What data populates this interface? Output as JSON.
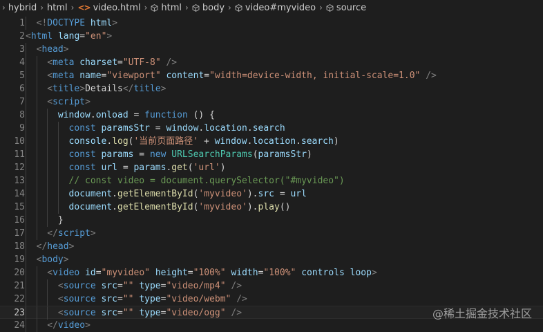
{
  "breadcrumb": [
    {
      "label": "hybrid",
      "icon": "chevron-right-icon"
    },
    {
      "label": "html",
      "icon": "folder-icon"
    },
    {
      "label": "video.html",
      "icon": "html-file-icon"
    },
    {
      "label": "html",
      "icon": "cube-icon"
    },
    {
      "label": "body",
      "icon": "cube-icon"
    },
    {
      "label": "video#myvideo",
      "icon": "cube-icon"
    },
    {
      "label": "source",
      "icon": "cube-icon"
    }
  ],
  "current_line": 23,
  "lines": [
    {
      "n": "1",
      "indent": 1,
      "tokens": [
        [
          "c-doc",
          "<!"
        ],
        [
          "c-tag",
          "DOCTYPE"
        ],
        [
          "c-txt",
          " "
        ],
        [
          "c-attr",
          "html"
        ],
        [
          "c-doc",
          ">"
        ]
      ]
    },
    {
      "n": "2",
      "indent": 0,
      "tokens": [
        [
          "c-br",
          "<"
        ],
        [
          "c-tag",
          "html"
        ],
        [
          "c-txt",
          " "
        ],
        [
          "c-attr",
          "lang"
        ],
        [
          "c-txt",
          "="
        ],
        [
          "c-str",
          "\"en\""
        ],
        [
          "c-br",
          ">"
        ]
      ]
    },
    {
      "n": "3",
      "indent": 1,
      "tokens": [
        [
          "c-br",
          "<"
        ],
        [
          "c-tag",
          "head"
        ],
        [
          "c-br",
          ">"
        ]
      ]
    },
    {
      "n": "4",
      "indent": 2,
      "tokens": [
        [
          "c-br",
          "<"
        ],
        [
          "c-tag",
          "meta"
        ],
        [
          "c-txt",
          " "
        ],
        [
          "c-attr",
          "charset"
        ],
        [
          "c-txt",
          "="
        ],
        [
          "c-str",
          "\"UTF-8\""
        ],
        [
          "c-txt",
          " "
        ],
        [
          "c-br",
          "/>"
        ]
      ]
    },
    {
      "n": "5",
      "indent": 2,
      "tokens": [
        [
          "c-br",
          "<"
        ],
        [
          "c-tag",
          "meta"
        ],
        [
          "c-txt",
          " "
        ],
        [
          "c-attr",
          "name"
        ],
        [
          "c-txt",
          "="
        ],
        [
          "c-str",
          "\"viewport\""
        ],
        [
          "c-txt",
          " "
        ],
        [
          "c-attr",
          "content"
        ],
        [
          "c-txt",
          "="
        ],
        [
          "c-str",
          "\"width=device-width, initial-scale=1.0\""
        ],
        [
          "c-txt",
          " "
        ],
        [
          "c-br",
          "/>"
        ]
      ]
    },
    {
      "n": "6",
      "indent": 2,
      "tokens": [
        [
          "c-br",
          "<"
        ],
        [
          "c-tag",
          "title"
        ],
        [
          "c-br",
          ">"
        ],
        [
          "c-txt",
          "Details"
        ],
        [
          "c-br",
          "</"
        ],
        [
          "c-tag",
          "title"
        ],
        [
          "c-br",
          ">"
        ]
      ]
    },
    {
      "n": "7",
      "indent": 2,
      "tokens": [
        [
          "c-br",
          "<"
        ],
        [
          "c-tag",
          "script"
        ],
        [
          "c-br",
          ">"
        ]
      ]
    },
    {
      "n": "8",
      "indent": 3,
      "tokens": [
        [
          "c-var",
          "window"
        ],
        [
          "c-txt",
          "."
        ],
        [
          "c-var",
          "onload"
        ],
        [
          "c-txt",
          " = "
        ],
        [
          "c-kw",
          "function"
        ],
        [
          "c-txt",
          " () {"
        ]
      ]
    },
    {
      "n": "9",
      "indent": 4,
      "tokens": [
        [
          "c-kw",
          "const"
        ],
        [
          "c-txt",
          " "
        ],
        [
          "c-var",
          "paramsStr"
        ],
        [
          "c-txt",
          " = "
        ],
        [
          "c-var",
          "window"
        ],
        [
          "c-txt",
          "."
        ],
        [
          "c-var",
          "location"
        ],
        [
          "c-txt",
          "."
        ],
        [
          "c-var",
          "search"
        ]
      ]
    },
    {
      "n": "10",
      "indent": 4,
      "tokens": [
        [
          "c-var",
          "console"
        ],
        [
          "c-txt",
          "."
        ],
        [
          "c-fn",
          "log"
        ],
        [
          "c-txt",
          "("
        ],
        [
          "c-str",
          "'当前页面路径'"
        ],
        [
          "c-txt",
          " + "
        ],
        [
          "c-var",
          "window"
        ],
        [
          "c-txt",
          "."
        ],
        [
          "c-var",
          "location"
        ],
        [
          "c-txt",
          "."
        ],
        [
          "c-var",
          "search"
        ],
        [
          "c-txt",
          ")"
        ]
      ]
    },
    {
      "n": "11",
      "indent": 4,
      "tokens": [
        [
          "c-kw",
          "const"
        ],
        [
          "c-txt",
          " "
        ],
        [
          "c-var",
          "params"
        ],
        [
          "c-txt",
          " = "
        ],
        [
          "c-kw",
          "new"
        ],
        [
          "c-txt",
          " "
        ],
        [
          "c-cls",
          "URLSearchParams"
        ],
        [
          "c-txt",
          "("
        ],
        [
          "c-var",
          "paramsStr"
        ],
        [
          "c-txt",
          ")"
        ]
      ]
    },
    {
      "n": "12",
      "indent": 4,
      "tokens": [
        [
          "c-kw",
          "const"
        ],
        [
          "c-txt",
          " "
        ],
        [
          "c-var",
          "url"
        ],
        [
          "c-txt",
          " = "
        ],
        [
          "c-var",
          "params"
        ],
        [
          "c-txt",
          "."
        ],
        [
          "c-fn",
          "get"
        ],
        [
          "c-txt",
          "("
        ],
        [
          "c-str",
          "'url'"
        ],
        [
          "c-txt",
          ")"
        ]
      ]
    },
    {
      "n": "13",
      "indent": 4,
      "tokens": [
        [
          "c-cmt",
          "// const video = document.querySelector(\"#myvideo\")"
        ]
      ]
    },
    {
      "n": "14",
      "indent": 4,
      "tokens": [
        [
          "c-var",
          "document"
        ],
        [
          "c-txt",
          "."
        ],
        [
          "c-fn",
          "getElementById"
        ],
        [
          "c-txt",
          "("
        ],
        [
          "c-str",
          "'myvideo'"
        ],
        [
          "c-txt",
          ")."
        ],
        [
          "c-var",
          "src"
        ],
        [
          "c-txt",
          " = "
        ],
        [
          "c-var",
          "url"
        ]
      ]
    },
    {
      "n": "15",
      "indent": 4,
      "tokens": [
        [
          "c-var",
          "document"
        ],
        [
          "c-txt",
          "."
        ],
        [
          "c-fn",
          "getElementById"
        ],
        [
          "c-txt",
          "("
        ],
        [
          "c-str",
          "'myvideo'"
        ],
        [
          "c-txt",
          ")."
        ],
        [
          "c-fn",
          "play"
        ],
        [
          "c-txt",
          "()"
        ]
      ]
    },
    {
      "n": "16",
      "indent": 3,
      "tokens": [
        [
          "c-txt",
          "}"
        ]
      ]
    },
    {
      "n": "17",
      "indent": 2,
      "tokens": [
        [
          "c-br",
          "</"
        ],
        [
          "c-tag",
          "script"
        ],
        [
          "c-br",
          ">"
        ]
      ]
    },
    {
      "n": "18",
      "indent": 1,
      "tokens": [
        [
          "c-br",
          "</"
        ],
        [
          "c-tag",
          "head"
        ],
        [
          "c-br",
          ">"
        ]
      ]
    },
    {
      "n": "19",
      "indent": 1,
      "tokens": [
        [
          "c-br",
          "<"
        ],
        [
          "c-tag",
          "body"
        ],
        [
          "c-br",
          ">"
        ]
      ]
    },
    {
      "n": "20",
      "indent": 2,
      "tokens": [
        [
          "c-br",
          "<"
        ],
        [
          "c-tag",
          "video"
        ],
        [
          "c-txt",
          " "
        ],
        [
          "c-attr",
          "id"
        ],
        [
          "c-txt",
          "="
        ],
        [
          "c-str",
          "\"myvideo\""
        ],
        [
          "c-txt",
          " "
        ],
        [
          "c-attr",
          "height"
        ],
        [
          "c-txt",
          "="
        ],
        [
          "c-str",
          "\"100%\""
        ],
        [
          "c-txt",
          " "
        ],
        [
          "c-attr",
          "width"
        ],
        [
          "c-txt",
          "="
        ],
        [
          "c-str",
          "\"100%\""
        ],
        [
          "c-txt",
          " "
        ],
        [
          "c-attr",
          "controls"
        ],
        [
          "c-txt",
          " "
        ],
        [
          "c-attr",
          "loop"
        ],
        [
          "c-br",
          ">"
        ]
      ]
    },
    {
      "n": "21",
      "indent": 3,
      "tokens": [
        [
          "c-br",
          "<"
        ],
        [
          "c-tag",
          "source"
        ],
        [
          "c-txt",
          " "
        ],
        [
          "c-attr",
          "src"
        ],
        [
          "c-txt",
          "="
        ],
        [
          "c-str",
          "\"\""
        ],
        [
          "c-txt",
          " "
        ],
        [
          "c-attr",
          "type"
        ],
        [
          "c-txt",
          "="
        ],
        [
          "c-str",
          "\"video/mp4\""
        ],
        [
          "c-txt",
          " "
        ],
        [
          "c-br",
          "/>"
        ]
      ]
    },
    {
      "n": "22",
      "indent": 3,
      "tokens": [
        [
          "c-br",
          "<"
        ],
        [
          "c-tag",
          "source"
        ],
        [
          "c-txt",
          " "
        ],
        [
          "c-attr",
          "src"
        ],
        [
          "c-txt",
          "="
        ],
        [
          "c-str",
          "\"\""
        ],
        [
          "c-txt",
          " "
        ],
        [
          "c-attr",
          "type"
        ],
        [
          "c-txt",
          "="
        ],
        [
          "c-str",
          "\"video/webm\""
        ],
        [
          "c-txt",
          " "
        ],
        [
          "c-br",
          "/>"
        ]
      ]
    },
    {
      "n": "23",
      "indent": 3,
      "tokens": [
        [
          "c-br",
          "<"
        ],
        [
          "c-tag",
          "source"
        ],
        [
          "c-txt",
          " "
        ],
        [
          "c-attr",
          "src"
        ],
        [
          "c-txt",
          "="
        ],
        [
          "c-str",
          "\"\""
        ],
        [
          "c-txt",
          " "
        ],
        [
          "c-attr",
          "type"
        ],
        [
          "c-txt",
          "="
        ],
        [
          "c-str",
          "\"video/ogg\""
        ],
        [
          "c-txt",
          " "
        ],
        [
          "c-br",
          "/>"
        ]
      ]
    },
    {
      "n": "24",
      "indent": 2,
      "tokens": [
        [
          "c-br",
          "</"
        ],
        [
          "c-tag",
          "video"
        ],
        [
          "c-br",
          ">"
        ]
      ]
    }
  ],
  "watermark": "@稀土掘金技术社区"
}
